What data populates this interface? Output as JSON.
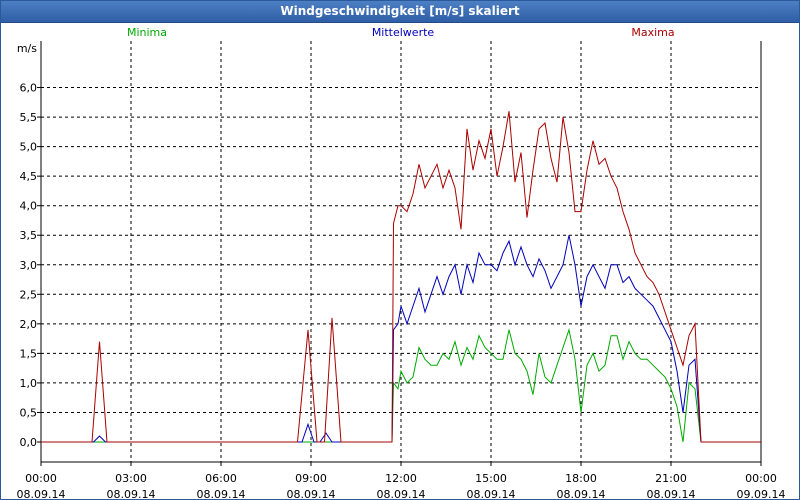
{
  "window": {
    "title": "Windgeschwindigkeit [m/s] skaliert"
  },
  "chart_data": {
    "type": "line",
    "title": "Windgeschwindigkeit [m/s] skaliert",
    "ylabel": "m/s",
    "xlabel": "",
    "ylim": [
      0,
      6.5
    ],
    "xlim": [
      0,
      24
    ],
    "x_unit": "hours since 08.09.14 00:00",
    "grid": true,
    "legend_placement": "top",
    "y_ticks": [
      "0,0",
      "0,5",
      "1,0",
      "1,5",
      "2,0",
      "2,5",
      "3,0",
      "3,5",
      "4,0",
      "4,5",
      "5,0",
      "5,5",
      "6,0"
    ],
    "x_ticks": [
      {
        "time": "00:00",
        "date": "08.09.14"
      },
      {
        "time": "03:00",
        "date": "08.09.14"
      },
      {
        "time": "06:00",
        "date": "08.09.14"
      },
      {
        "time": "09:00",
        "date": "08.09.14"
      },
      {
        "time": "12:00",
        "date": "08.09.14"
      },
      {
        "time": "15:00",
        "date": "08.09.14"
      },
      {
        "time": "18:00",
        "date": "08.09.14"
      },
      {
        "time": "21:00",
        "date": "08.09.14"
      },
      {
        "time": "00:00",
        "date": "09.09.14"
      }
    ],
    "series": [
      {
        "name": "Minima",
        "color": "#00aa00",
        "points": [
          [
            0,
            0
          ],
          [
            1.7,
            0
          ],
          [
            1.95,
            0
          ],
          [
            2.2,
            0
          ],
          [
            8.9,
            0
          ],
          [
            9.4,
            0
          ],
          [
            11.7,
            0
          ],
          [
            11.75,
            1.0
          ],
          [
            11.9,
            0.9
          ],
          [
            12.0,
            1.2
          ],
          [
            12.2,
            1.0
          ],
          [
            12.4,
            1.1
          ],
          [
            12.6,
            1.6
          ],
          [
            12.8,
            1.4
          ],
          [
            13.0,
            1.3
          ],
          [
            13.2,
            1.3
          ],
          [
            13.4,
            1.5
          ],
          [
            13.6,
            1.4
          ],
          [
            13.8,
            1.7
          ],
          [
            14.0,
            1.3
          ],
          [
            14.2,
            1.6
          ],
          [
            14.4,
            1.4
          ],
          [
            14.6,
            1.8
          ],
          [
            14.8,
            1.6
          ],
          [
            15.0,
            1.5
          ],
          [
            15.2,
            1.4
          ],
          [
            15.4,
            1.4
          ],
          [
            15.6,
            1.9
          ],
          [
            15.8,
            1.5
          ],
          [
            16.0,
            1.4
          ],
          [
            16.2,
            1.2
          ],
          [
            16.4,
            0.8
          ],
          [
            16.6,
            1.5
          ],
          [
            16.8,
            1.1
          ],
          [
            17.0,
            1.0
          ],
          [
            17.2,
            1.3
          ],
          [
            17.4,
            1.6
          ],
          [
            17.6,
            1.9
          ],
          [
            17.8,
            1.4
          ],
          [
            18.0,
            0.5
          ],
          [
            18.2,
            1.3
          ],
          [
            18.4,
            1.5
          ],
          [
            18.6,
            1.2
          ],
          [
            18.8,
            1.3
          ],
          [
            19.0,
            1.8
          ],
          [
            19.2,
            1.8
          ],
          [
            19.4,
            1.4
          ],
          [
            19.6,
            1.7
          ],
          [
            19.8,
            1.5
          ],
          [
            20.0,
            1.4
          ],
          [
            20.2,
            1.4
          ],
          [
            20.4,
            1.3
          ],
          [
            20.6,
            1.2
          ],
          [
            20.8,
            1.1
          ],
          [
            21.0,
            0.9
          ],
          [
            21.2,
            0.6
          ],
          [
            21.4,
            0.0
          ],
          [
            21.6,
            1.0
          ],
          [
            21.8,
            0.9
          ],
          [
            22.0,
            0.0
          ],
          [
            24,
            0
          ]
        ]
      },
      {
        "name": "Mittelwerte",
        "color": "#0000bb",
        "points": [
          [
            0,
            0
          ],
          [
            1.75,
            0
          ],
          [
            1.95,
            0.1
          ],
          [
            2.15,
            0
          ],
          [
            8.7,
            0
          ],
          [
            8.9,
            0.3
          ],
          [
            9.1,
            0
          ],
          [
            9.3,
            0
          ],
          [
            9.5,
            0.15
          ],
          [
            9.7,
            0
          ],
          [
            11.7,
            0
          ],
          [
            11.75,
            1.9
          ],
          [
            11.9,
            2.0
          ],
          [
            12.0,
            2.3
          ],
          [
            12.2,
            2.0
          ],
          [
            12.4,
            2.3
          ],
          [
            12.6,
            2.6
          ],
          [
            12.8,
            2.2
          ],
          [
            13.0,
            2.5
          ],
          [
            13.2,
            2.8
          ],
          [
            13.4,
            2.5
          ],
          [
            13.6,
            2.8
          ],
          [
            13.8,
            3.0
          ],
          [
            14.0,
            2.5
          ],
          [
            14.2,
            3.0
          ],
          [
            14.4,
            2.7
          ],
          [
            14.6,
            3.2
          ],
          [
            14.8,
            3.0
          ],
          [
            15.0,
            3.0
          ],
          [
            15.2,
            2.9
          ],
          [
            15.4,
            3.2
          ],
          [
            15.6,
            3.4
          ],
          [
            15.8,
            3.0
          ],
          [
            16.0,
            3.3
          ],
          [
            16.2,
            3.0
          ],
          [
            16.4,
            2.8
          ],
          [
            16.6,
            3.1
          ],
          [
            16.8,
            2.9
          ],
          [
            17.0,
            2.6
          ],
          [
            17.2,
            2.8
          ],
          [
            17.4,
            3.0
          ],
          [
            17.6,
            3.5
          ],
          [
            17.8,
            3.0
          ],
          [
            18.0,
            2.3
          ],
          [
            18.2,
            2.8
          ],
          [
            18.4,
            3.0
          ],
          [
            18.6,
            2.8
          ],
          [
            18.8,
            2.6
          ],
          [
            19.0,
            3.0
          ],
          [
            19.2,
            3.0
          ],
          [
            19.4,
            2.7
          ],
          [
            19.6,
            2.8
          ],
          [
            19.8,
            2.6
          ],
          [
            20.0,
            2.5
          ],
          [
            20.2,
            2.4
          ],
          [
            20.4,
            2.3
          ],
          [
            20.6,
            2.1
          ],
          [
            20.8,
            1.9
          ],
          [
            21.0,
            1.7
          ],
          [
            21.2,
            1.2
          ],
          [
            21.4,
            0.5
          ],
          [
            21.6,
            1.3
          ],
          [
            21.8,
            1.4
          ],
          [
            22.0,
            0.0
          ],
          [
            24,
            0
          ]
        ]
      },
      {
        "name": "Maxima",
        "color": "#aa0000",
        "points": [
          [
            0,
            0
          ],
          [
            1.7,
            0
          ],
          [
            1.95,
            1.7
          ],
          [
            2.2,
            0
          ],
          [
            8.55,
            0
          ],
          [
            8.9,
            1.9
          ],
          [
            9.2,
            0
          ],
          [
            9.45,
            0
          ],
          [
            9.7,
            2.1
          ],
          [
            10.0,
            0
          ],
          [
            11.7,
            0
          ],
          [
            11.75,
            3.7
          ],
          [
            11.9,
            4.0
          ],
          [
            12.0,
            4.0
          ],
          [
            12.2,
            3.9
          ],
          [
            12.4,
            4.2
          ],
          [
            12.6,
            4.7
          ],
          [
            12.8,
            4.3
          ],
          [
            13.0,
            4.5
          ],
          [
            13.2,
            4.7
          ],
          [
            13.4,
            4.3
          ],
          [
            13.6,
            4.6
          ],
          [
            13.8,
            4.3
          ],
          [
            14.0,
            3.6
          ],
          [
            14.2,
            5.3
          ],
          [
            14.4,
            4.6
          ],
          [
            14.6,
            5.1
          ],
          [
            14.8,
            4.8
          ],
          [
            15.0,
            5.3
          ],
          [
            15.2,
            4.5
          ],
          [
            15.4,
            5.0
          ],
          [
            15.6,
            5.6
          ],
          [
            15.8,
            4.4
          ],
          [
            16.0,
            4.9
          ],
          [
            16.2,
            3.8
          ],
          [
            16.4,
            4.6
          ],
          [
            16.6,
            5.3
          ],
          [
            16.8,
            5.4
          ],
          [
            17.0,
            4.8
          ],
          [
            17.2,
            4.4
          ],
          [
            17.4,
            5.5
          ],
          [
            17.6,
            4.9
          ],
          [
            17.8,
            3.9
          ],
          [
            18.0,
            3.9
          ],
          [
            18.2,
            4.6
          ],
          [
            18.4,
            5.1
          ],
          [
            18.6,
            4.7
          ],
          [
            18.8,
            4.8
          ],
          [
            19.0,
            4.5
          ],
          [
            19.2,
            4.3
          ],
          [
            19.4,
            3.9
          ],
          [
            19.6,
            3.6
          ],
          [
            19.8,
            3.2
          ],
          [
            20.0,
            3.0
          ],
          [
            20.2,
            2.8
          ],
          [
            20.4,
            2.7
          ],
          [
            20.6,
            2.5
          ],
          [
            20.8,
            2.2
          ],
          [
            21.0,
            1.9
          ],
          [
            21.2,
            1.6
          ],
          [
            21.4,
            1.3
          ],
          [
            21.6,
            1.8
          ],
          [
            21.8,
            2.0
          ],
          [
            22.0,
            0.0
          ],
          [
            24,
            0
          ]
        ]
      }
    ]
  }
}
